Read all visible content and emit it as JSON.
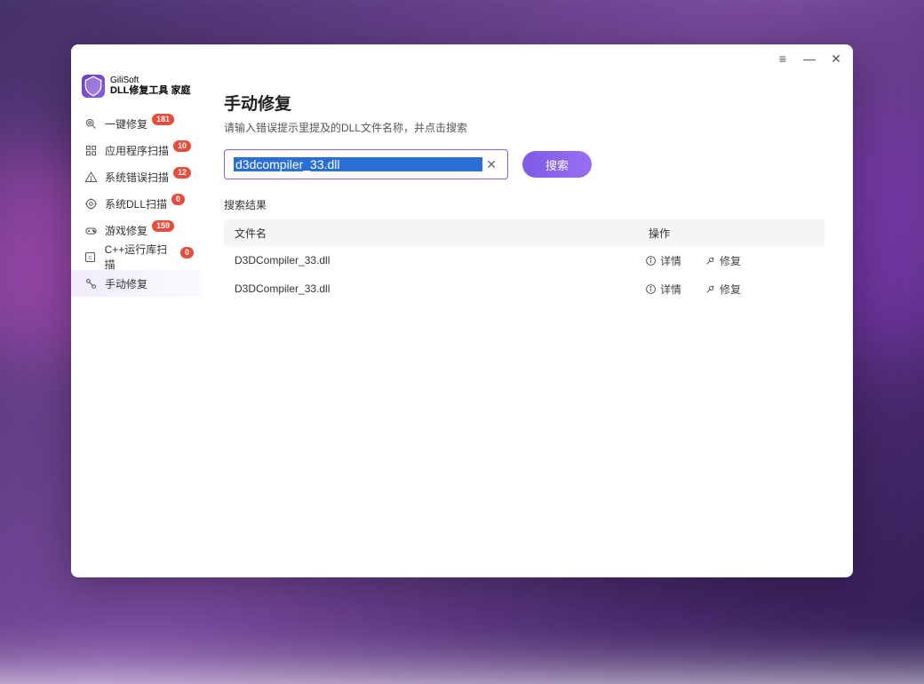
{
  "brand": {
    "line1": "GiliSoft",
    "line2": "DLL修复工具 家庭"
  },
  "titlebar": {
    "menu": "≡",
    "min": "—",
    "close": "✕"
  },
  "sidebar": {
    "items": [
      {
        "label": "一键修复",
        "badge": "181",
        "icon": "magnify-icon"
      },
      {
        "label": "应用程序扫描",
        "badge": "10",
        "icon": "app-scan-icon"
      },
      {
        "label": "系统错误扫描",
        "badge": "12",
        "icon": "error-scan-icon"
      },
      {
        "label": "系统DLL扫描",
        "badge": "0",
        "icon": "dll-scan-icon"
      },
      {
        "label": "游戏修复",
        "badge": "159",
        "icon": "game-icon"
      },
      {
        "label": "C++运行库扫描",
        "badge": "0",
        "icon": "runtime-icon"
      },
      {
        "label": "手动修复",
        "badge": null,
        "icon": "manual-icon"
      }
    ]
  },
  "main": {
    "title": "手动修复",
    "subtitle": "请输入错误提示里提及的DLL文件名称，并点击搜索",
    "search_value": "d3dcompiler_33.dll",
    "search_btn": "搜索",
    "results_label": "搜索结果",
    "columns": {
      "file": "文件名",
      "op": "操作"
    },
    "op_labels": {
      "detail": "详情",
      "repair": "修复"
    },
    "rows": [
      {
        "file": "D3DCompiler_33.dll"
      },
      {
        "file": "D3DCompiler_33.dll"
      }
    ]
  }
}
